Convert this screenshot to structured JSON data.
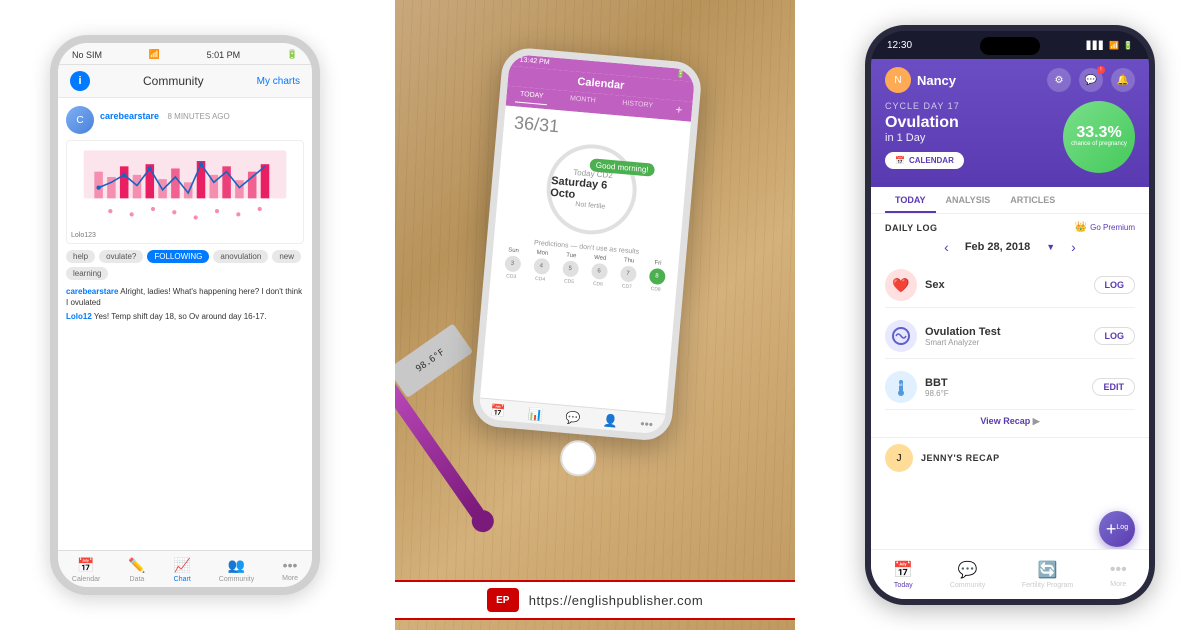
{
  "phone1": {
    "status_bar": {
      "carrier": "No SIM",
      "wifi": "wifi",
      "time": "5:01 PM",
      "battery": "battery"
    },
    "header": {
      "community_label": "Community",
      "my_charts_label": "My charts"
    },
    "post": {
      "username": "carebearstare",
      "time_ago": "8 MINUTES AGO",
      "chart_author": "Lolo123"
    },
    "tags": [
      "help",
      "ovulate?",
      "anovulation",
      "new",
      "learning"
    ],
    "following_tag": "FOLLOWING",
    "chat": [
      {
        "user": "carebearstare",
        "text": " Alright, ladies! What's happening here? I don't think I ovulated"
      },
      {
        "user": "Lolo12",
        "text": " Yes! Temp shift day 18, so Ov around day 16-17."
      }
    ],
    "bottom_nav": [
      "Calendar",
      "Data",
      "Chart",
      "Community",
      "More"
    ]
  },
  "middle": {
    "phone2": {
      "status": "13:42 PM",
      "header": "Calendar",
      "tabs": [
        "TODAY",
        "MONTH",
        "HISTORY"
      ],
      "cycle_day": "36/31",
      "today_label": "Today CD2",
      "today_sub": "Saturday 6 Octo",
      "not_fertile": "Not f",
      "good_morning": "Good morning!",
      "predictions_label": "Predictions — don't use as results",
      "days": [
        {
          "name": "Sun",
          "code": "CD3",
          "color": "#e0e0e0"
        },
        {
          "name": "Mon",
          "code": "CD4",
          "color": "#e0e0e0"
        },
        {
          "name": "Tue",
          "code": "CD5",
          "color": "#e0e0e0"
        },
        {
          "name": "Wed",
          "code": "CD6",
          "color": "#e0e0e0"
        },
        {
          "name": "Thu",
          "code": "CD7",
          "color": "#e0e0e0"
        },
        {
          "name": "Fri",
          "code": "CD8",
          "color": "#4caf50"
        }
      ],
      "bottom_nav": [
        "Calendar",
        "Mensuration",
        "Profile",
        "More"
      ]
    },
    "ep_logo": "EP",
    "ep_url": "https://englishpublisher.com"
  },
  "phone3": {
    "status_bar": {
      "time": "12:30",
      "icons": "signal wifi battery"
    },
    "user": {
      "name": "Nancy",
      "avatar_initial": "N"
    },
    "header_icons": [
      "gear",
      "chat",
      "bell"
    ],
    "cycle": {
      "cycle_day_label": "CYCLE DAY 17",
      "status": "Ovulation",
      "in_days": "in 1 Day",
      "calendar_btn": "CALENDAR",
      "pregnancy_pct": "33.3%",
      "pregnancy_label": "chance of pregnancy"
    },
    "tabs": [
      "TODAY",
      "ANALYSIS",
      "ARTICLES"
    ],
    "daily_log": {
      "title": "DAILY LOG",
      "premium_label": "Go Premium",
      "date": "Feb 28, 2018",
      "items": [
        {
          "icon": "❤️",
          "icon_bg": "#ffe0e0",
          "name": "Sex",
          "sub": "",
          "btn": "LOG"
        },
        {
          "icon": "🔵",
          "icon_bg": "#e0e8ff",
          "name": "Ovulation Test",
          "sub": "Smart Analyzer",
          "btn": "LOG"
        },
        {
          "icon": "🌡️",
          "icon_bg": "#e0f0ff",
          "name": "BBT",
          "sub": "98.6°F",
          "btn": "EDIT"
        }
      ],
      "view_recap": "View Recap"
    },
    "recap": {
      "name": "JENNY'S RECAP",
      "avatar": "J"
    },
    "bottom_nav": [
      {
        "label": "Today",
        "icon": "📅",
        "active": true
      },
      {
        "label": "Community",
        "icon": "💬",
        "active": false
      },
      {
        "label": "Fertility Program",
        "icon": "🔄",
        "active": false
      },
      {
        "label": "More",
        "icon": "···",
        "active": false
      }
    ]
  }
}
